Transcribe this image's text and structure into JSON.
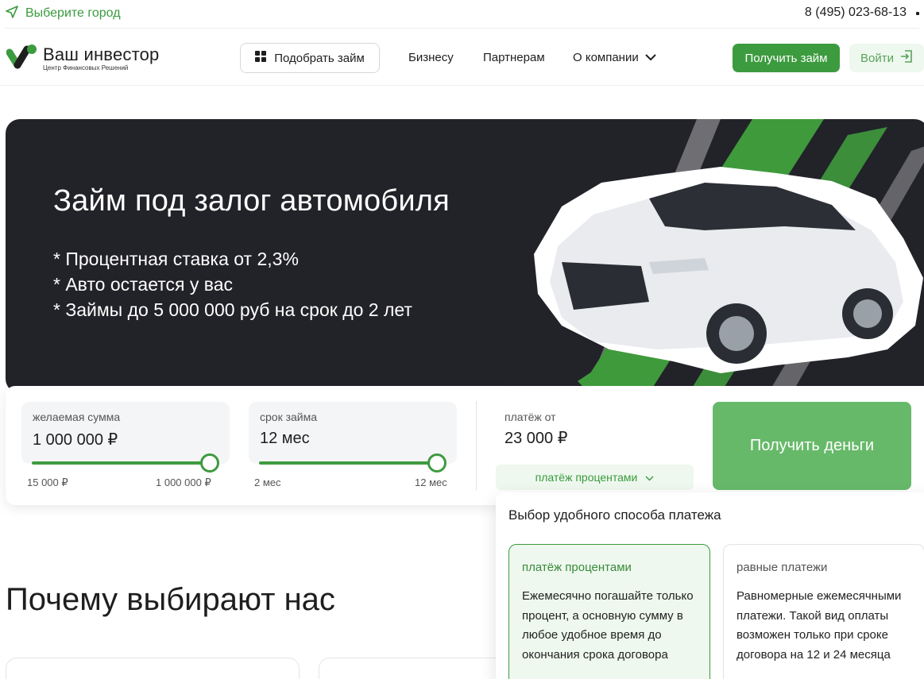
{
  "topbar": {
    "city_label": "Выберите город",
    "phone": "8 (495) 023-68-13"
  },
  "header": {
    "logo_title": "Ваш инвестор",
    "logo_subtitle": "Центр Финансовых Решений",
    "pick_loan": "Подобрать займ",
    "nav": [
      "Бизнесу",
      "Партнерам",
      "О компании"
    ],
    "get_loan": "Получить займ",
    "login": "Войти"
  },
  "hero": {
    "title": "Займ под залог автомобиля",
    "bullets": [
      "* Процентная ставка от 2,3%",
      "* Авто остается у вас",
      "* Займы до 5 000 000 руб на срок до 2 лет"
    ]
  },
  "calculator": {
    "amount": {
      "label": "желаемая сумма",
      "value": "1 000 000 ₽",
      "min": "15 000 ₽",
      "max": "1 000 000 ₽",
      "fraction": 1.0
    },
    "term": {
      "label": "срок займа",
      "value": "12 мес",
      "min": "2 мес",
      "max": "12 мес",
      "fraction": 1.0
    },
    "payment": {
      "label": "платёж от",
      "value": "23 000 ₽"
    },
    "payment_type": "платёж процентами",
    "cta": "Получить деньги"
  },
  "payment_dropdown": {
    "title": "Выбор удобного способа платежа",
    "options": [
      {
        "title": "платёж процентами",
        "desc": "Ежемесячно погашайте только процент, а основную сумму в любое удобное время до окончания срока договора",
        "selected": true
      },
      {
        "title": "равные платежи",
        "desc": "Равномерные ежемесячными платежи. Такой вид оплаты возможен только при сроке договора на 12 и 24 месяца",
        "selected": false
      }
    ]
  },
  "why": {
    "title": "Почему выбирают нас"
  },
  "colors": {
    "accent": "#3d9b3f",
    "accent_light": "#eef8ee",
    "hero_bg": "#222229"
  }
}
